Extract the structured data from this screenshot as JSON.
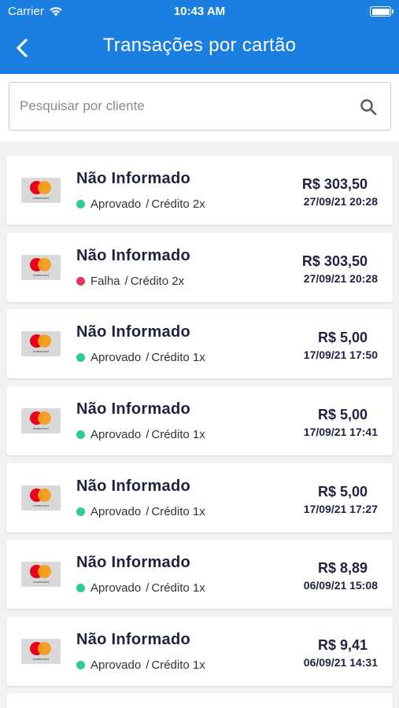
{
  "status_bar": {
    "carrier": "Carrier",
    "time": "10:43 AM"
  },
  "header": {
    "title": "Transações por cartão",
    "background_color": "#1a7fe0"
  },
  "search": {
    "placeholder": "Pesquisar por cliente",
    "value": ""
  },
  "colors": {
    "approved": "#2ecc8f",
    "failed": "#e8365a"
  },
  "transactions": [
    {
      "name": "Não Informado",
      "status": "Aprovado",
      "status_type": "approved",
      "payment": "Crédito 2x",
      "amount": "R$ 303,50",
      "datetime": "27/09/21 20:28",
      "card_icon": "mastercard-icon",
      "card_text": "mastercard"
    },
    {
      "name": "Não Informado",
      "status": "Falha",
      "status_type": "failed",
      "payment": "Crédito 2x",
      "amount": "R$ 303,50",
      "datetime": "27/09/21 20:28",
      "card_icon": "mastercard-icon",
      "card_text": "mastercard"
    },
    {
      "name": "Não Informado",
      "status": "Aprovado",
      "status_type": "approved",
      "payment": "Crédito 1x",
      "amount": "R$ 5,00",
      "datetime": "17/09/21 17:50",
      "card_icon": "mastercard-icon",
      "card_text": "mastercard"
    },
    {
      "name": "Não Informado",
      "status": "Aprovado",
      "status_type": "approved",
      "payment": "Crédito 1x",
      "amount": "R$ 5,00",
      "datetime": "17/09/21 17:41",
      "card_icon": "mastercard-icon",
      "card_text": "mastercard"
    },
    {
      "name": "Não Informado",
      "status": "Aprovado",
      "status_type": "approved",
      "payment": "Crédito 1x",
      "amount": "R$ 5,00",
      "datetime": "17/09/21 17:27",
      "card_icon": "mastercard-icon",
      "card_text": "mastercard"
    },
    {
      "name": "Não Informado",
      "status": "Aprovado",
      "status_type": "approved",
      "payment": "Crédito 1x",
      "amount": "R$ 8,89",
      "datetime": "06/09/21 15:08",
      "card_icon": "mastercard-icon",
      "card_text": "mastercard"
    },
    {
      "name": "Não Informado",
      "status": "Aprovado",
      "status_type": "approved",
      "payment": "Crédito 1x",
      "amount": "R$ 9,41",
      "datetime": "06/09/21 14:31",
      "card_icon": "mastercard-icon",
      "card_text": "mastercard"
    }
  ]
}
